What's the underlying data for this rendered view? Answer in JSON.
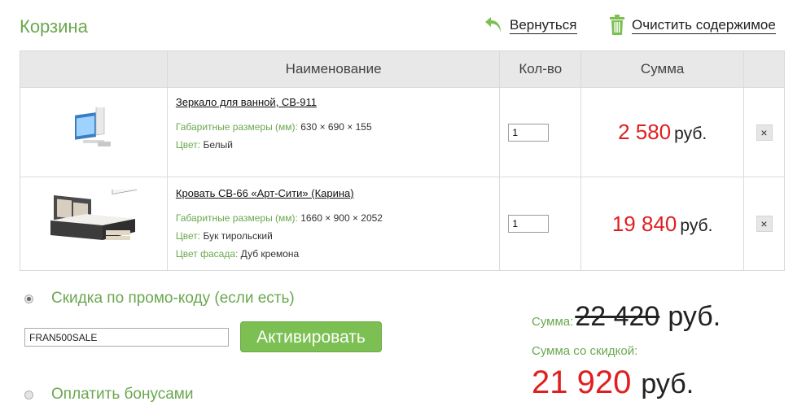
{
  "page": {
    "title": "Корзина"
  },
  "header": {
    "back_label": "Вернуться",
    "clear_label": "Очистить содержимое"
  },
  "table": {
    "columns": [
      "",
      "Наименование",
      "Кол-во",
      "Сумма",
      ""
    ],
    "rows": [
      {
        "name": "Зеркало для ванной, СВ-911",
        "attrs": [
          {
            "key": "Габаритные размеры (мм):",
            "value": "630 × 690 × 155"
          },
          {
            "key": "Цвет:",
            "value": "Белый"
          }
        ],
        "qty": "1",
        "sum": "2 580",
        "currency": "руб.",
        "delete_label": "×"
      },
      {
        "name": "Кровать СВ-66 «Арт-Сити» (Карина)",
        "attrs": [
          {
            "key": "Габаритные размеры (мм):",
            "value": "1660 × 900 × 2052"
          },
          {
            "key": "Цвет:",
            "value": "Бук тирольский"
          },
          {
            "key": "Цвет фасада:",
            "value": "Дуб кремона"
          }
        ],
        "qty": "1",
        "sum": "19 840",
        "currency": "руб.",
        "delete_label": "×"
      }
    ]
  },
  "promo": {
    "option_label": "Скидка по промо-коду (если есть)",
    "selected": true,
    "code_value": "FRAN500SALE",
    "activate_label": "Активировать"
  },
  "bonus": {
    "option_label": "Оплатить бонусами",
    "selected": false
  },
  "totals": {
    "sum_label": "Сумма:",
    "sum_old": "22 420",
    "currency": "руб.",
    "discount_label": "Сумма со скидкой:",
    "discount_sum": "21 920"
  },
  "colors": {
    "accent": "#6aa84f",
    "price": "#e02020",
    "button": "#7cbf52"
  },
  "icons": {
    "back": "return-arrow-icon",
    "clear": "trash-icon"
  }
}
